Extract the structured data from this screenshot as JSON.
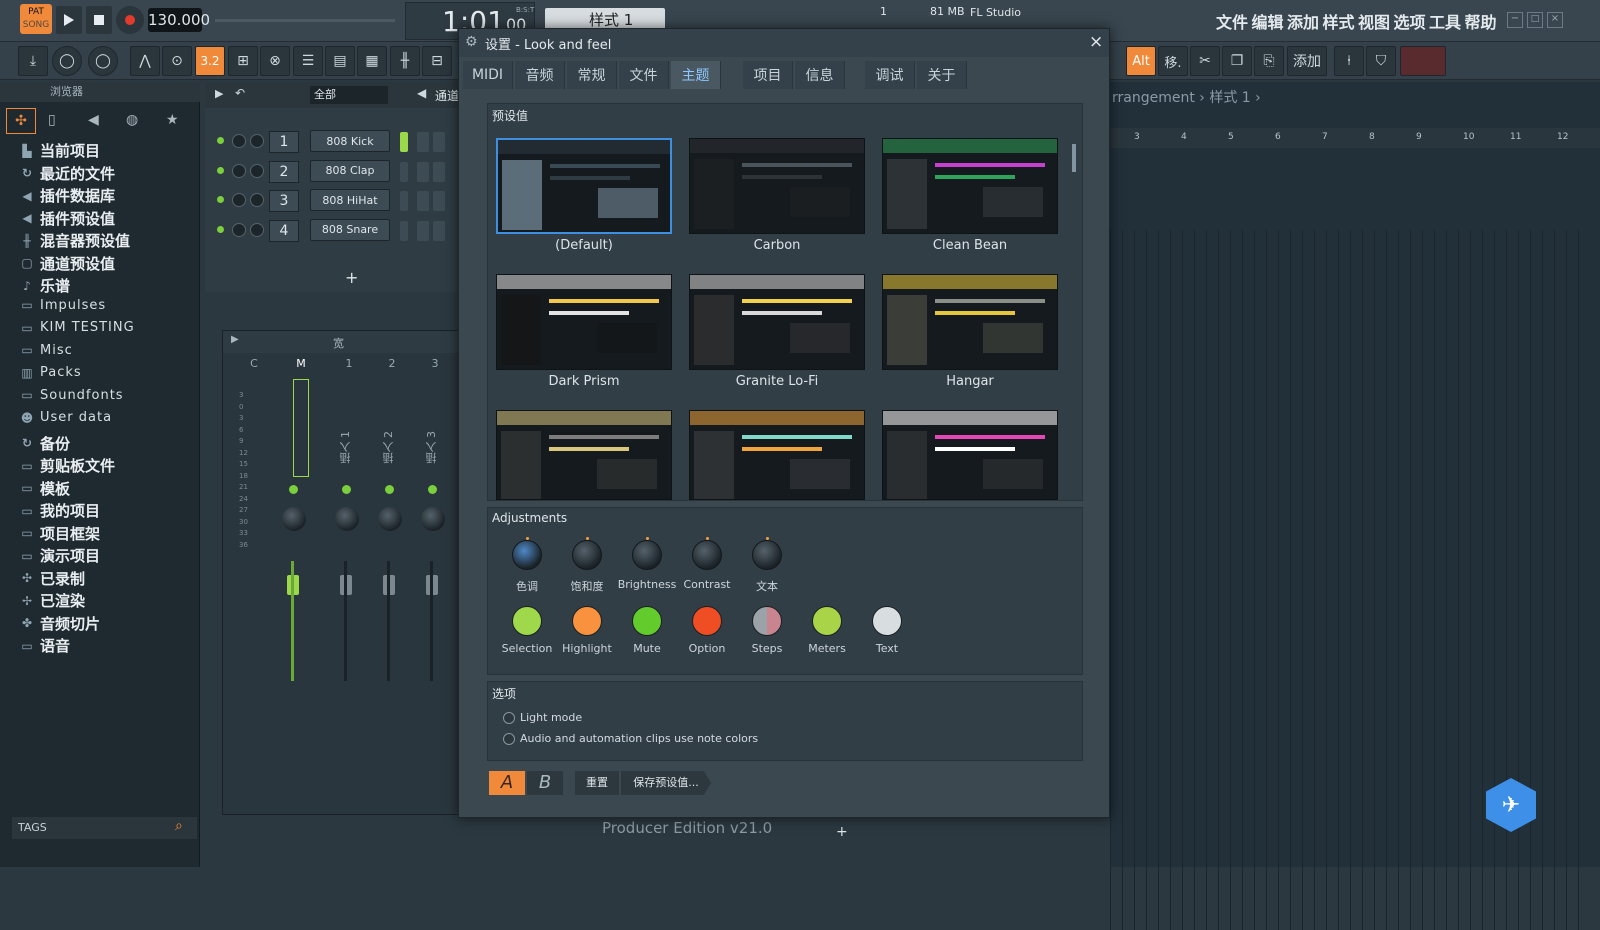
{
  "topbar": {
    "pat_label": "PAT",
    "song_label": "SONG",
    "tempo": "130.000",
    "time_display": "1:01",
    "time_sub": "00",
    "time_bst": "B:S:T",
    "pattern_name": "样式 1",
    "cpu_number": "1",
    "memory": "81 MB",
    "app_name": "FL Studio",
    "menu": [
      "文件",
      "编辑",
      "添加",
      "样式",
      "视图",
      "选项",
      "工具",
      "帮助"
    ]
  },
  "toolbar": {
    "snap_label": "3.2",
    "alt_label": "Alt",
    "move_label": "移.",
    "add_label": "添加"
  },
  "browser": {
    "header": "浏览器",
    "items": [
      {
        "label": "当前项目",
        "icon": "project-icon"
      },
      {
        "label": "最近的文件",
        "icon": "folder-recent-icon"
      },
      {
        "label": "插件数据库",
        "icon": "plugin-icon"
      },
      {
        "label": "插件预设值",
        "icon": "plugin-icon"
      },
      {
        "label": "混音器预设值",
        "icon": "mixer-icon"
      },
      {
        "label": "通道预设值",
        "icon": "channel-icon"
      },
      {
        "label": "乐谱",
        "icon": "note-icon"
      },
      {
        "label": "Impulses",
        "icon": "folder-icon"
      },
      {
        "label": "KIM TESTING",
        "icon": "folder-icon"
      },
      {
        "label": "Misc",
        "icon": "folder-icon"
      },
      {
        "label": "Packs",
        "icon": "packs-icon"
      },
      {
        "label": "Soundfonts",
        "icon": "folder-icon"
      },
      {
        "label": "User data",
        "icon": "user-icon"
      },
      {
        "label": "备份",
        "icon": "folder-recent-icon"
      },
      {
        "label": "剪贴板文件",
        "icon": "folder-icon"
      },
      {
        "label": "模板",
        "icon": "folder-icon"
      },
      {
        "label": "我的项目",
        "icon": "folder-icon"
      },
      {
        "label": "项目框架",
        "icon": "folder-icon"
      },
      {
        "label": "演示项目",
        "icon": "folder-icon"
      },
      {
        "label": "已录制",
        "icon": "recorded-icon"
      },
      {
        "label": "已渲染",
        "icon": "rendered-icon"
      },
      {
        "label": "音频切片",
        "icon": "slice-icon"
      },
      {
        "label": "语音",
        "icon": "folder-icon"
      }
    ],
    "tags_label": "TAGS"
  },
  "rack": {
    "filter": "全部",
    "title": "通道",
    "channels": [
      {
        "num": "1",
        "name": "808 Kick"
      },
      {
        "num": "2",
        "name": "808 Clap"
      },
      {
        "num": "3",
        "name": "808 HiHat"
      },
      {
        "num": "4",
        "name": "808 Snare"
      }
    ],
    "add_label": "+"
  },
  "mixer": {
    "wide_label": "宽",
    "columns": [
      "C",
      "M",
      "1",
      "2",
      "3"
    ],
    "inserts": [
      "插入 1",
      "插入 2",
      "插入 3"
    ],
    "scale": [
      "3",
      "0",
      "3",
      "6",
      "9",
      "12",
      "15",
      "18",
      "21",
      "24",
      "27",
      "30",
      "33",
      "36"
    ]
  },
  "playlist": {
    "breadcrumb": "rrangement › 样式 1 ›",
    "bars": [
      "3",
      "4",
      "5",
      "6",
      "7",
      "8",
      "9",
      "10",
      "11",
      "12"
    ]
  },
  "status": {
    "edition": "Producer Edition v21.0"
  },
  "dialog": {
    "title": "设置 - Look and feel",
    "tabs": [
      "MIDI",
      "音频",
      "常规",
      "文件",
      "主题",
      "项目",
      "信息",
      "调试",
      "关于"
    ],
    "active_tab": "主题",
    "presets_label": "预设值",
    "presets": [
      "(Default)",
      "Carbon",
      "Clean Bean",
      "Dark Prism",
      "Granite Lo-Fi",
      "Hangar"
    ],
    "adjustments_label": "Adjustments",
    "knobs": [
      "色调",
      "饱和度",
      "Brightness",
      "Contrast",
      "文本"
    ],
    "swatches": [
      {
        "label": "Selection",
        "color": "#9fd84a"
      },
      {
        "label": "Highlight",
        "color": "#f8923e"
      },
      {
        "label": "Mute",
        "color": "#63cc2c"
      },
      {
        "label": "Option",
        "color": "#ef4d24"
      },
      {
        "label": "Steps",
        "color": "#c8858f"
      },
      {
        "label": "Meters",
        "color": "#a9d448"
      },
      {
        "label": "Text",
        "color": "#d8dde0"
      }
    ],
    "options_label": "选项",
    "options": [
      "Light mode",
      "Audio and automation clips use note colors"
    ],
    "a_label": "A",
    "b_label": "B",
    "reset_label": "重置",
    "save_preset_label": "保存预设值..."
  },
  "colors": {
    "accent": "#3f8fe0",
    "orange": "#f08a3a",
    "active_tab_text": "#8ec7ff"
  }
}
